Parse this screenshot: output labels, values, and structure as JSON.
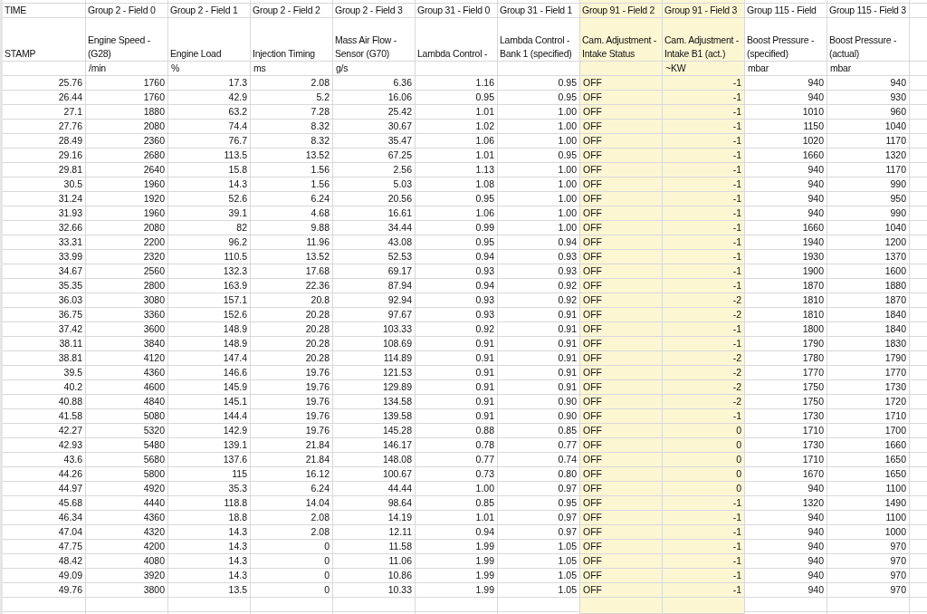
{
  "columns": [
    {
      "group": "TIME",
      "name_lines": [
        "STAMP"
      ],
      "kind": "number",
      "highlighted": false
    },
    {
      "group": "Group 2 - Field 0",
      "name_lines": [
        "Engine Speed -",
        "(G28)"
      ],
      "unit": "/min",
      "kind": "number",
      "highlighted": false
    },
    {
      "group": "Group 2 - Field 1",
      "name_lines": [
        "Engine Load"
      ],
      "unit": "%",
      "kind": "number",
      "highlighted": false
    },
    {
      "group": "Group 2 - Field 2",
      "name_lines": [
        "Injection Timing"
      ],
      "unit": "ms",
      "kind": "number",
      "highlighted": false
    },
    {
      "group": "Group 2 - Field 3",
      "name_lines": [
        "Mass Air Flow -",
        "Sensor (G70)"
      ],
      "unit": "g/s",
      "kind": "number",
      "highlighted": false
    },
    {
      "group": "Group 31 - Field 0",
      "name_lines": [
        "Lambda Control -"
      ],
      "kind": "number",
      "highlighted": false
    },
    {
      "group": "Group 31 - Field 1",
      "name_lines": [
        "Lambda Control -",
        "Bank 1 (specified)"
      ],
      "kind": "number",
      "highlighted": false
    },
    {
      "group": "Group 91 - Field 2",
      "name_lines": [
        "Cam. Adjustment -",
        "Intake Status"
      ],
      "kind": "text",
      "highlighted": true
    },
    {
      "group": "Group 91 - Field 3",
      "name_lines": [
        "Cam. Adjustment -",
        "Intake B1 (act.)"
      ],
      "unit": "~KW",
      "kind": "number",
      "highlighted": true
    },
    {
      "group": "Group 115 - Field",
      "name_lines": [
        "Boost Pressure -",
        "(specified)"
      ],
      "unit": "mbar",
      "kind": "number",
      "highlighted": false
    },
    {
      "group": "Group 115 - Field 3",
      "name_lines": [
        "Boost Pressure -",
        "(actual)"
      ],
      "unit": "mbar",
      "kind": "number",
      "highlighted": false
    }
  ],
  "rows": [
    [
      "25.76",
      "1760",
      "17.3",
      "2.08",
      "6.36",
      "1.16",
      "0.95",
      "OFF",
      "-1",
      "940",
      "940"
    ],
    [
      "26.44",
      "1760",
      "42.9",
      "5.2",
      "16.06",
      "0.95",
      "0.95",
      "OFF",
      "-1",
      "940",
      "930"
    ],
    [
      "27.1",
      "1880",
      "63.2",
      "7.28",
      "25.42",
      "1.01",
      "1.00",
      "OFF",
      "-1",
      "1010",
      "960"
    ],
    [
      "27.76",
      "2080",
      "74.4",
      "8.32",
      "30.67",
      "1.02",
      "1.00",
      "OFF",
      "-1",
      "1150",
      "1040"
    ],
    [
      "28.49",
      "2360",
      "76.7",
      "8.32",
      "35.47",
      "1.06",
      "1.00",
      "OFF",
      "-1",
      "1020",
      "1170"
    ],
    [
      "29.16",
      "2680",
      "113.5",
      "13.52",
      "67.25",
      "1.01",
      "0.95",
      "OFF",
      "-1",
      "1660",
      "1320"
    ],
    [
      "29.81",
      "2640",
      "15.8",
      "1.56",
      "2.56",
      "1.13",
      "1.00",
      "OFF",
      "-1",
      "940",
      "1170"
    ],
    [
      "30.5",
      "1960",
      "14.3",
      "1.56",
      "5.03",
      "1.08",
      "1.00",
      "OFF",
      "-1",
      "940",
      "990"
    ],
    [
      "31.24",
      "1920",
      "52.6",
      "6.24",
      "20.56",
      "0.95",
      "1.00",
      "OFF",
      "-1",
      "940",
      "950"
    ],
    [
      "31.93",
      "1960",
      "39.1",
      "4.68",
      "16.61",
      "1.06",
      "1.00",
      "OFF",
      "-1",
      "940",
      "990"
    ],
    [
      "32.66",
      "2080",
      "82",
      "9.88",
      "34.44",
      "0.99",
      "1.00",
      "OFF",
      "-1",
      "1660",
      "1040"
    ],
    [
      "33.31",
      "2200",
      "96.2",
      "11.96",
      "43.08",
      "0.95",
      "0.94",
      "OFF",
      "-1",
      "1940",
      "1200"
    ],
    [
      "33.99",
      "2320",
      "110.5",
      "13.52",
      "52.53",
      "0.94",
      "0.93",
      "OFF",
      "-1",
      "1930",
      "1370"
    ],
    [
      "34.67",
      "2560",
      "132.3",
      "17.68",
      "69.17",
      "0.93",
      "0.93",
      "OFF",
      "-1",
      "1900",
      "1600"
    ],
    [
      "35.35",
      "2800",
      "163.9",
      "22.36",
      "87.94",
      "0.94",
      "0.92",
      "OFF",
      "-1",
      "1870",
      "1880"
    ],
    [
      "36.03",
      "3080",
      "157.1",
      "20.8",
      "92.94",
      "0.93",
      "0.92",
      "OFF",
      "-2",
      "1810",
      "1870"
    ],
    [
      "36.75",
      "3360",
      "152.6",
      "20.28",
      "97.67",
      "0.93",
      "0.91",
      "OFF",
      "-2",
      "1810",
      "1840"
    ],
    [
      "37.42",
      "3600",
      "148.9",
      "20.28",
      "103.33",
      "0.92",
      "0.91",
      "OFF",
      "-1",
      "1800",
      "1840"
    ],
    [
      "38.11",
      "3840",
      "148.9",
      "20.28",
      "108.69",
      "0.91",
      "0.91",
      "OFF",
      "-1",
      "1790",
      "1830"
    ],
    [
      "38.81",
      "4120",
      "147.4",
      "20.28",
      "114.89",
      "0.91",
      "0.91",
      "OFF",
      "-2",
      "1780",
      "1790"
    ],
    [
      "39.5",
      "4360",
      "146.6",
      "19.76",
      "121.53",
      "0.91",
      "0.91",
      "OFF",
      "-2",
      "1770",
      "1770"
    ],
    [
      "40.2",
      "4600",
      "145.9",
      "19.76",
      "129.89",
      "0.91",
      "0.91",
      "OFF",
      "-2",
      "1750",
      "1730"
    ],
    [
      "40.88",
      "4840",
      "145.1",
      "19.76",
      "134.58",
      "0.91",
      "0.90",
      "OFF",
      "-2",
      "1750",
      "1720"
    ],
    [
      "41.58",
      "5080",
      "144.4",
      "19.76",
      "139.58",
      "0.91",
      "0.90",
      "OFF",
      "-1",
      "1730",
      "1710"
    ],
    [
      "42.27",
      "5320",
      "142.9",
      "19.76",
      "145.28",
      "0.88",
      "0.85",
      "OFF",
      "0",
      "1710",
      "1700"
    ],
    [
      "42.93",
      "5480",
      "139.1",
      "21.84",
      "146.17",
      "0.78",
      "0.77",
      "OFF",
      "0",
      "1730",
      "1660"
    ],
    [
      "43.6",
      "5680",
      "137.6",
      "21.84",
      "148.08",
      "0.77",
      "0.74",
      "OFF",
      "0",
      "1710",
      "1650"
    ],
    [
      "44.26",
      "5800",
      "115",
      "16.12",
      "100.67",
      "0.73",
      "0.80",
      "OFF",
      "0",
      "1670",
      "1650"
    ],
    [
      "44.97",
      "4920",
      "35.3",
      "6.24",
      "44.44",
      "1.00",
      "0.97",
      "OFF",
      "0",
      "940",
      "1100"
    ],
    [
      "45.68",
      "4440",
      "118.8",
      "14.04",
      "98.64",
      "0.85",
      "0.95",
      "OFF",
      "-1",
      "1320",
      "1490"
    ],
    [
      "46.34",
      "4360",
      "18.8",
      "2.08",
      "14.19",
      "1.01",
      "0.97",
      "OFF",
      "-1",
      "940",
      "1100"
    ],
    [
      "47.04",
      "4320",
      "14.3",
      "2.08",
      "12.11",
      "0.94",
      "0.97",
      "OFF",
      "-1",
      "940",
      "1000"
    ],
    [
      "47.75",
      "4200",
      "14.3",
      "0",
      "11.58",
      "1.99",
      "1.05",
      "OFF",
      "-1",
      "940",
      "970"
    ],
    [
      "48.42",
      "4080",
      "14.3",
      "0",
      "11.06",
      "1.99",
      "1.05",
      "OFF",
      "-1",
      "940",
      "970"
    ],
    [
      "49.09",
      "3920",
      "14.3",
      "0",
      "10.86",
      "1.99",
      "1.05",
      "OFF",
      "-1",
      "940",
      "970"
    ],
    [
      "49.76",
      "3800",
      "13.5",
      "0",
      "10.33",
      "1.99",
      "1.05",
      "OFF",
      "-1",
      "940",
      "970"
    ]
  ]
}
